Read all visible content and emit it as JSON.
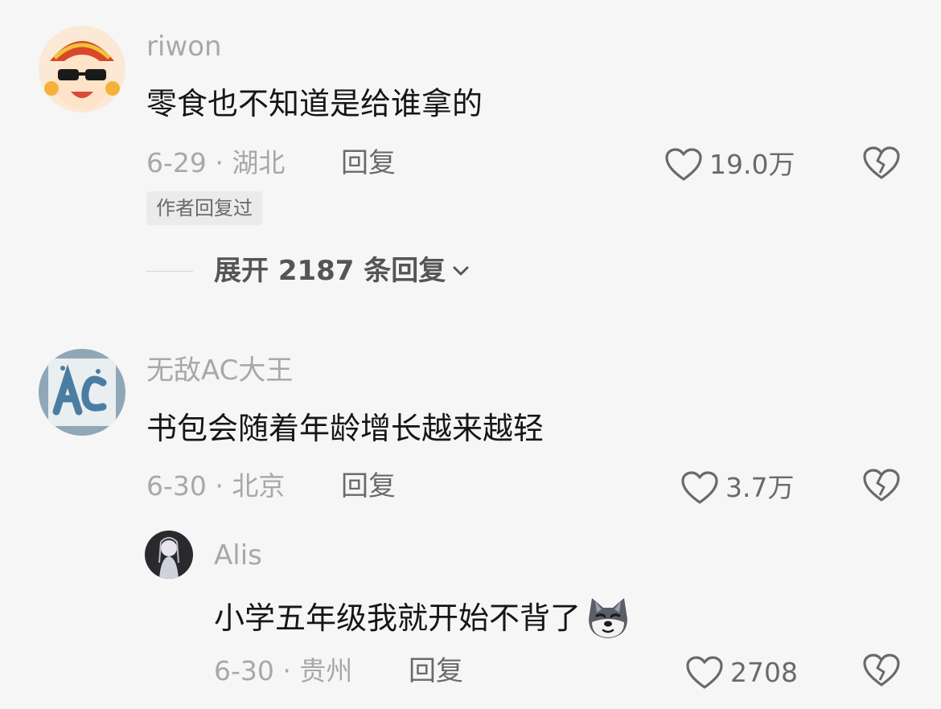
{
  "comments": [
    {
      "username": "riwon",
      "text": "零食也不知道是给谁拿的",
      "meta": "6-29 · 湖北",
      "reply_label": "回复",
      "likes": "19.0万",
      "author_tag": "作者回复过",
      "expand_label": "展开 2187 条回复"
    },
    {
      "username": "无敌AC大王",
      "text": "书包会随着年龄增长越来越轻",
      "meta": "6-30 · 北京",
      "reply_label": "回复",
      "likes": "3.7万",
      "replies": [
        {
          "username": "Alis",
          "text": "小学五年级我就开始不背了",
          "meta": "6-30 · 贵州",
          "reply_label": "回复",
          "likes": "2708"
        }
      ]
    }
  ],
  "colors": {
    "background": "#f6f6f6",
    "text_primary": "#161616",
    "text_secondary": "#a8a8a8",
    "text_action": "#6a6a6a"
  },
  "icons": [
    "heart-icon",
    "broken-heart-icon",
    "chevron-down-icon",
    "wolf-emoji-icon"
  ]
}
